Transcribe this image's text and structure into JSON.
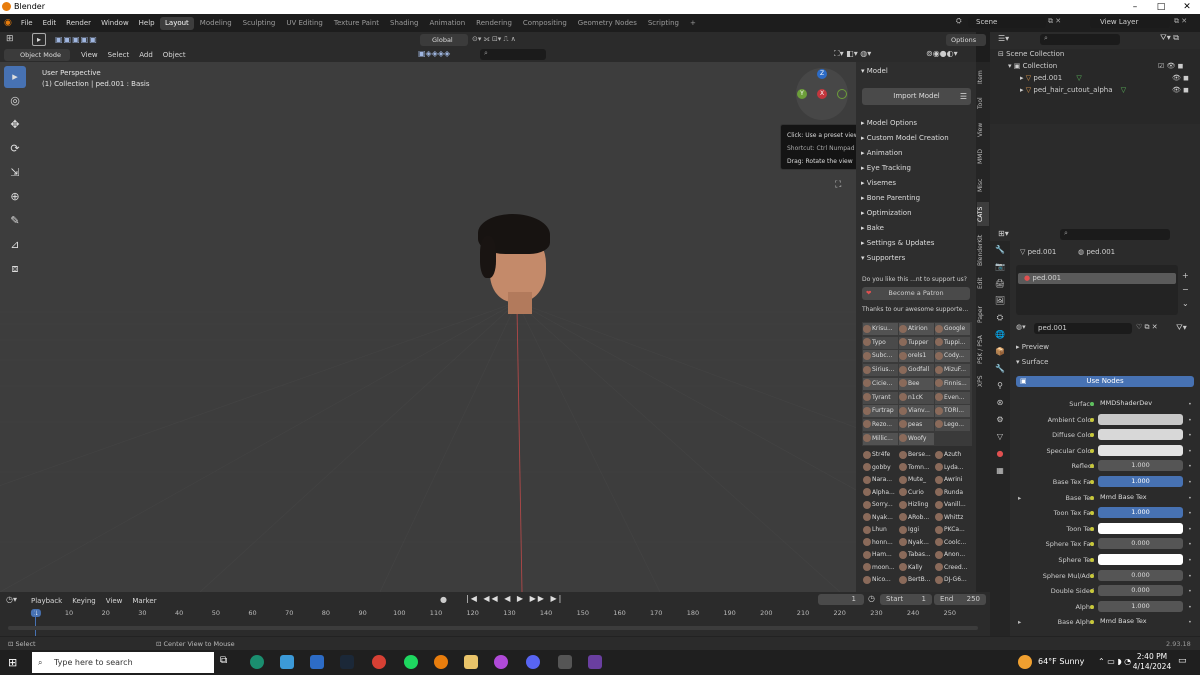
{
  "window": {
    "title": "Blender",
    "minimize": "–",
    "maximize": "□",
    "close": "✕"
  },
  "menu": {
    "items": [
      "File",
      "Edit",
      "Render",
      "Window",
      "Help"
    ]
  },
  "workspaces": [
    "Layout",
    "Modeling",
    "Sculpting",
    "UV Editing",
    "Texture Paint",
    "Shading",
    "Animation",
    "Rendering",
    "Compositing",
    "Geometry Nodes",
    "Scripting",
    "+"
  ],
  "scene": {
    "scene_label": "Scene",
    "view_layer_label": "View Layer"
  },
  "viewport_header": {
    "mode": "Object Mode",
    "menus": [
      "View",
      "Select",
      "Add",
      "Object"
    ],
    "orientation": "Global",
    "options": "Options"
  },
  "viewport": {
    "perspective": "User Perspective",
    "collection_info": "(1) Collection | ped.001 : Basis"
  },
  "gizmo": {
    "axes": [
      "Z",
      "Y",
      "X"
    ]
  },
  "tooltip": {
    "line1": "Click: Use a preset viewpoint",
    "line2": "Shortcut: Ctrl Numpad 3",
    "line3": "Drag: Rotate the view"
  },
  "npanel": {
    "header": "Model",
    "import_button": "Import Model",
    "sections": [
      "Model Options",
      "Custom Model Creation",
      "Animation",
      "Eye Tracking",
      "Visemes",
      "Bone Parenting",
      "Optimization",
      "Bake",
      "Settings & Updates",
      "Supporters"
    ],
    "supporters_question": "Do you like this ...nt to support us?",
    "patron_button": "Become a Patron",
    "thanks": "Thanks to our awesome supporte...",
    "supporters_a": [
      "Krisu...",
      "Atirion",
      "Google",
      "Typo",
      "Tupper",
      "Tuppi...",
      "Subc...",
      "orels1",
      "Cody...",
      "Sirius...",
      "Godfall",
      "MizuF...",
      "Cicie...",
      "Bee",
      "Finnis...",
      "Tyrant",
      "n1cK",
      "Even...",
      "Furtrap",
      "Vianv...",
      "TORI...",
      "Rezo...",
      "peas",
      "Lego...",
      "Millic...",
      "Woofy"
    ],
    "supporters_b": [
      "Str4fe",
      "Berse...",
      "Azuth",
      "gobby",
      "Tomn...",
      "Lyda...",
      "Nara...",
      "Mute_",
      "Awrini",
      "Alpha...",
      "Curio",
      "Runda",
      "Sorry...",
      "Hizling",
      "Vanill...",
      "Nyak...",
      "ARob...",
      "Whittz",
      "Lhun",
      "Iggi",
      "PKCa...",
      "honn...",
      "Nyak...",
      "Coolc...",
      "Ham...",
      "Tabas...",
      "Anon...",
      "moon...",
      "Kally",
      "Creed...",
      "Nico...",
      "BertB...",
      "DJ-G6..."
    ]
  },
  "vtabs": [
    "Item",
    "Tool",
    "View",
    "MMD",
    "Misc",
    "CATS",
    "BlenderKit",
    "Edit",
    "Paper",
    "PSK / PSA",
    "XPS"
  ],
  "outliner": {
    "root": "Scene Collection",
    "collection": "Collection",
    "items": [
      "ped.001",
      "ped_hair_cutout_alpha"
    ]
  },
  "properties": {
    "object": "ped.001",
    "mesh": "ped.001",
    "material_slot": "ped.001",
    "material": "ped.001",
    "preview": "Preview",
    "surface": "Surface",
    "use_nodes": "Use Nodes",
    "rows": [
      {
        "label": "Surface",
        "value": "MMDShaderDev"
      },
      {
        "label": "Ambient Color",
        "value": ""
      },
      {
        "label": "Diffuse Color",
        "value": ""
      },
      {
        "label": "Specular Color",
        "value": ""
      },
      {
        "label": "Reflect",
        "value": "1.000"
      },
      {
        "label": "Base Tex Fac",
        "value": "1.000"
      },
      {
        "label": "Base Tex",
        "value": "Mmd Base Tex"
      },
      {
        "label": "Toon Tex Fac",
        "value": "1.000"
      },
      {
        "label": "Toon Tex",
        "value": ""
      },
      {
        "label": "Sphere Tex Fac",
        "value": "0.000"
      },
      {
        "label": "Sphere Tex",
        "value": ""
      },
      {
        "label": "Sphere Mul/Add",
        "value": "0.000"
      },
      {
        "label": "Double Sided",
        "value": "0.000"
      },
      {
        "label": "Alpha",
        "value": "1.000"
      },
      {
        "label": "Base Alpha",
        "value": "Mmd Base Tex"
      }
    ]
  },
  "timeline": {
    "menus": [
      "Playback",
      "Keying",
      "View",
      "Marker"
    ],
    "current_frame": "1",
    "start_label": "Start",
    "start": "1",
    "end_label": "End",
    "end": "250",
    "ticks": [
      "1",
      "10",
      "20",
      "30",
      "40",
      "50",
      "60",
      "70",
      "80",
      "90",
      "100",
      "110",
      "120",
      "130",
      "140",
      "150",
      "160",
      "170",
      "180",
      "190",
      "200",
      "210",
      "220",
      "230",
      "240",
      "250"
    ]
  },
  "status": {
    "left": "Select",
    "middle": "Center View to Mouse",
    "version": "2.93.18"
  },
  "taskbar": {
    "search": "Type here to search",
    "weather": "64°F  Sunny",
    "time": "2:40 PM",
    "date": "4/14/2024"
  }
}
